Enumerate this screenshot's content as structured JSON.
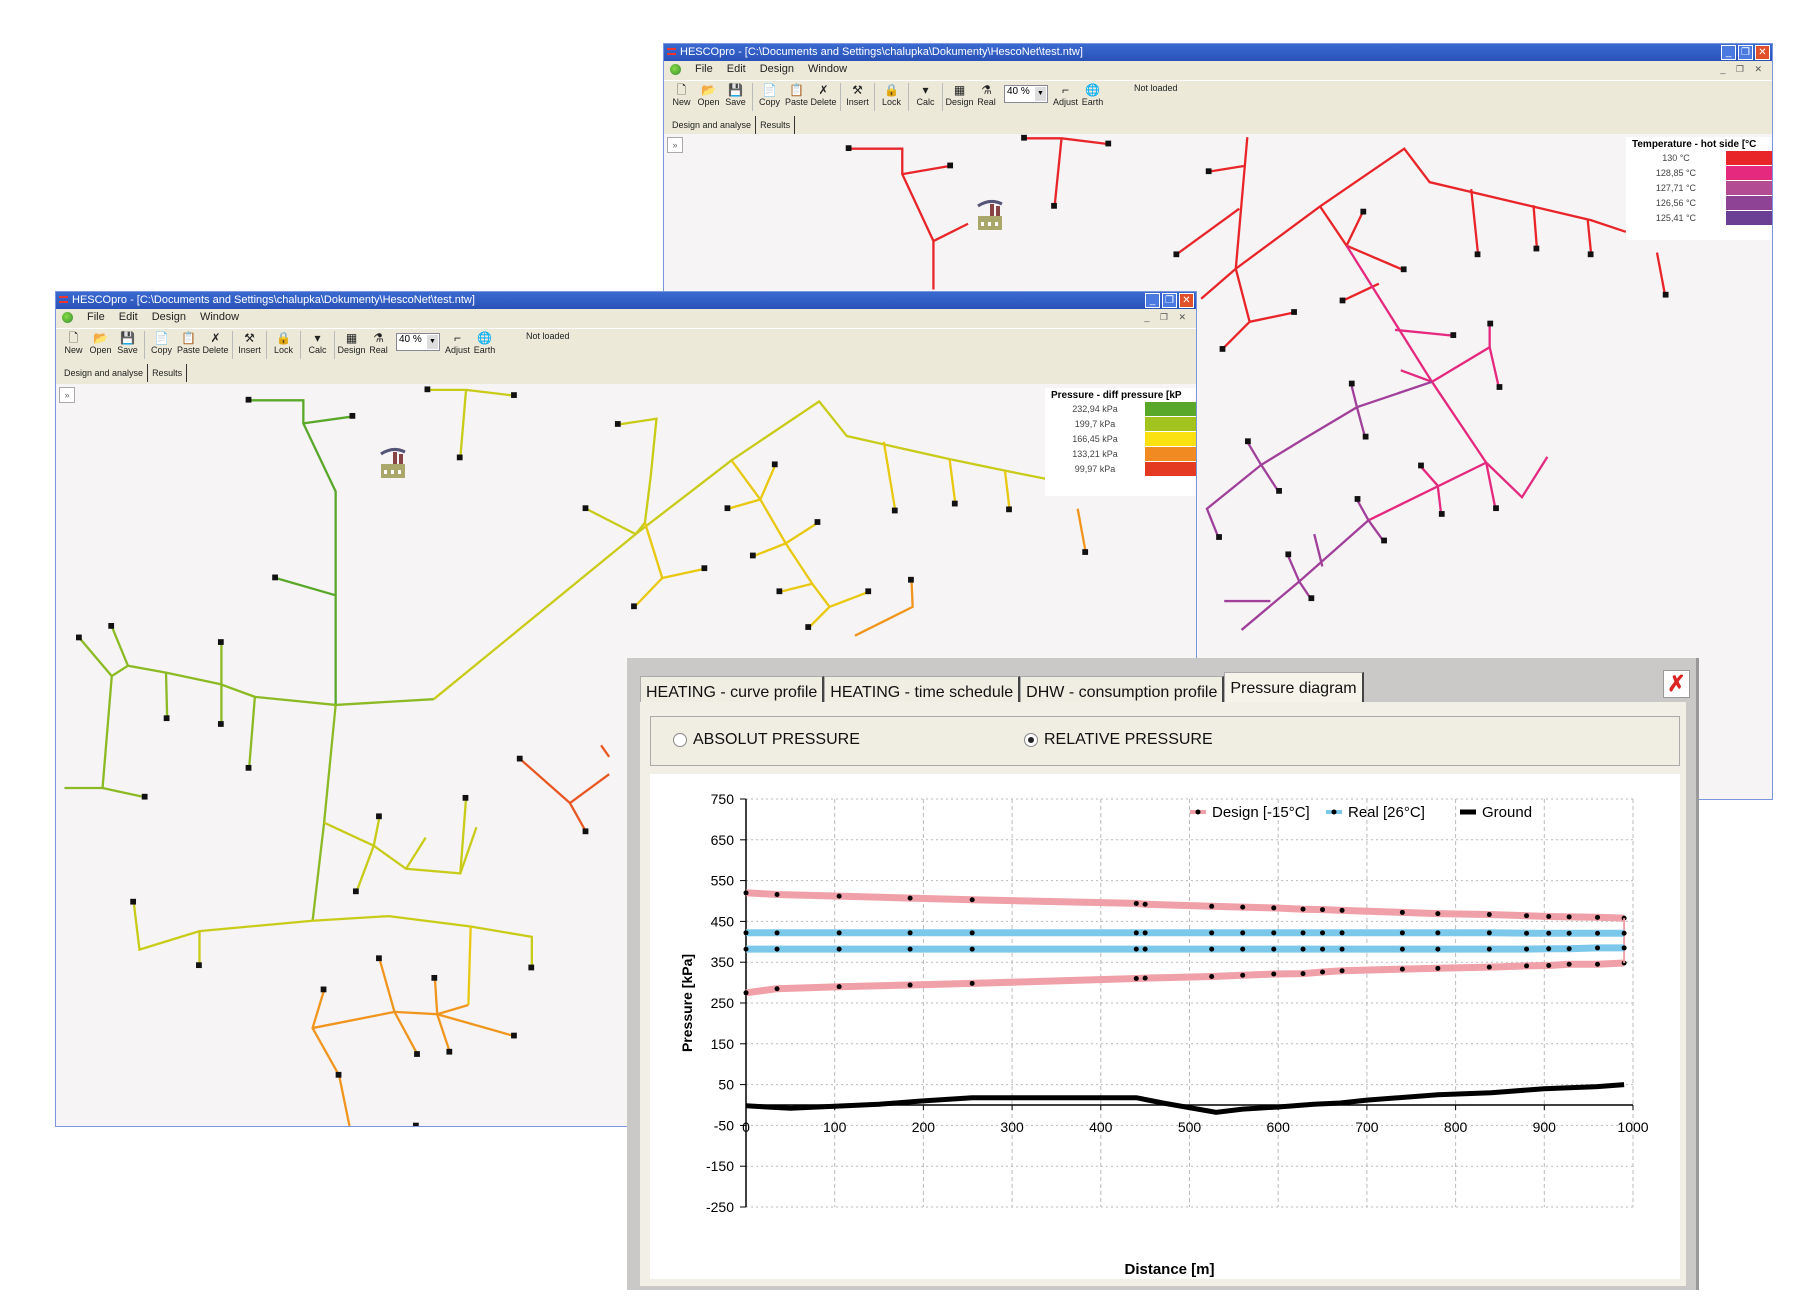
{
  "app": {
    "title": "HESCOpro - [C:\\Documents and Settings\\chalupka\\Dokumenty\\HescoNet\\test.ntw]",
    "menu": [
      "File",
      "Edit",
      "Design",
      "Window"
    ],
    "window_buttons": [
      "_",
      "❐",
      "✕"
    ],
    "mdi_buttons": "_ ❐ ✕",
    "toolbar": [
      {
        "label": "New",
        "icon": "🗋"
      },
      {
        "label": "Open",
        "icon": "📂"
      },
      {
        "label": "Save",
        "icon": "💾"
      },
      {
        "label": "Copy",
        "icon": "📄"
      },
      {
        "label": "Paste",
        "icon": "📋"
      },
      {
        "label": "Delete",
        "icon": "✗"
      },
      {
        "label": "Insert",
        "icon": "⚒"
      },
      {
        "label": "Lock",
        "icon": "🔒"
      },
      {
        "label": "Calc",
        "icon": "▾"
      },
      {
        "label": "Design",
        "icon": "▦"
      },
      {
        "label": "Real",
        "icon": "⚗"
      },
      {
        "label": "Adjust",
        "icon": "⌐"
      },
      {
        "label": "Earth",
        "icon": "🌐"
      }
    ],
    "zoom_value": "40 %",
    "status": "Not loaded",
    "doc_tabs": [
      "Design and analyse",
      "Results"
    ],
    "expander": "»"
  },
  "back_window": {
    "legend": {
      "title": "Temperature - hot side [°C",
      "items": [
        {
          "label": "130 °C",
          "color": "#e8262a"
        },
        {
          "label": "128,85 °C",
          "color": "#e4297e"
        },
        {
          "label": "127,71 °C",
          "color": "#b44c94"
        },
        {
          "label": "126,56 °C",
          "color": "#8e4394"
        },
        {
          "label": "125,41 °C",
          "color": "#6a3f94"
        }
      ]
    }
  },
  "front_window": {
    "legend": {
      "title": "Pressure - diff pressure [kP",
      "items": [
        {
          "label": "232,94 kPa",
          "color": "#5aa82a"
        },
        {
          "label": "199,7 kPa",
          "color": "#a2c21e"
        },
        {
          "label": "166,45 kPa",
          "color": "#fbe012"
        },
        {
          "label": "133,21 kPa",
          "color": "#f28a22"
        },
        {
          "label": "99,97 kPa",
          "color": "#e43a22"
        }
      ]
    }
  },
  "dialog": {
    "tabs": [
      "HEATING - curve profile",
      "HEATING - time schedule",
      "DHW - consumption profile",
      "Pressure diagram"
    ],
    "active_tab": "Pressure diagram",
    "close_icon": "✗",
    "radio": {
      "absolute": "ABSOLUT PRESSURE",
      "relative": "RELATIVE PRESSURE",
      "selected": "relative"
    }
  },
  "chart_data": {
    "type": "line",
    "xlabel": "Distance [m]",
    "ylabel": "Pressure [kPa]",
    "xlim": [
      0,
      1000
    ],
    "ylim": [
      -250,
      750
    ],
    "xticks": [
      0,
      100,
      200,
      300,
      400,
      500,
      600,
      700,
      800,
      900,
      1000
    ],
    "yticks": [
      750,
      650,
      550,
      450,
      350,
      250,
      150,
      50,
      -50,
      -150,
      -250
    ],
    "grid": true,
    "legend_position": "top-right",
    "x": [
      0,
      35,
      105,
      185,
      255,
      440,
      450,
      525,
      560,
      595,
      628,
      650,
      672,
      740,
      780,
      838,
      880,
      905,
      928,
      960,
      990
    ],
    "series": [
      {
        "name": "Design [-15°C]",
        "color": "#f0a0a8",
        "lines": [
          [
            520,
            516,
            512,
            507,
            503,
            494,
            492,
            487,
            485,
            483,
            480,
            479,
            477,
            472,
            469,
            467,
            464,
            462,
            461,
            460,
            458
          ],
          [
            275,
            285,
            290,
            294,
            298,
            310,
            311,
            315,
            318,
            321,
            322,
            326,
            329,
            333,
            335,
            338,
            341,
            342,
            345,
            345,
            348
          ]
        ]
      },
      {
        "name": "Real [26°C]",
        "color": "#7cc8ea",
        "lines": [
          [
            422,
            422,
            422,
            422,
            422,
            422,
            422,
            422,
            422,
            422,
            422,
            422,
            422,
            422,
            422,
            422,
            421,
            421,
            421,
            421,
            421
          ],
          [
            382,
            382,
            382,
            382,
            382,
            382,
            382,
            382,
            382,
            382,
            382,
            382,
            382,
            382,
            382,
            382,
            382,
            383,
            383,
            385,
            385
          ]
        ]
      },
      {
        "name": "Ground",
        "color": "#000000",
        "points": [
          [
            0,
            -2
          ],
          [
            50,
            -8
          ],
          [
            100,
            -3
          ],
          [
            150,
            2
          ],
          [
            200,
            10
          ],
          [
            255,
            18
          ],
          [
            440,
            18
          ],
          [
            470,
            5
          ],
          [
            530,
            -18
          ],
          [
            560,
            -10
          ],
          [
            600,
            -5
          ],
          [
            640,
            2
          ],
          [
            670,
            5
          ],
          [
            700,
            12
          ],
          [
            780,
            25
          ],
          [
            840,
            30
          ],
          [
            900,
            40
          ],
          [
            960,
            45
          ],
          [
            990,
            50
          ]
        ]
      }
    ]
  }
}
